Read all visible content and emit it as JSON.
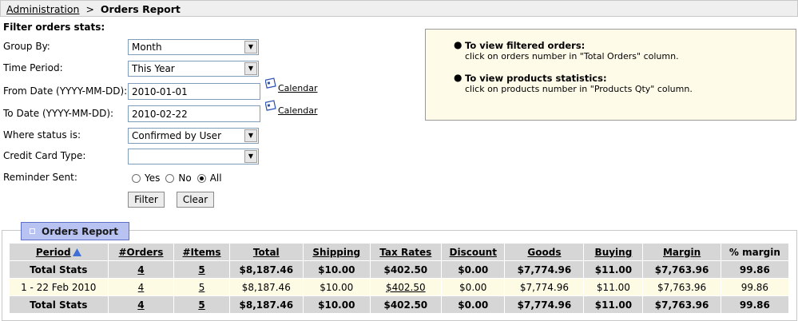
{
  "breadcrumb": {
    "parent": "Administration",
    "separator": ">",
    "current": "Orders Report"
  },
  "filter": {
    "title": "Filter orders stats:",
    "group_by": {
      "label": "Group By:",
      "value": "Month"
    },
    "time_period": {
      "label": "Time Period:",
      "value": "This Year"
    },
    "from_date": {
      "label": "From Date (YYYY-MM-DD):",
      "value": "2010-01-01",
      "calendar_label": "Calendar"
    },
    "to_date": {
      "label": "To Date (YYYY-MM-DD):",
      "value": "2010-02-22",
      "calendar_label": "Calendar"
    },
    "status": {
      "label": "Where status is:",
      "value": "Confirmed by User"
    },
    "credit_card": {
      "label": "Credit Card Type:",
      "value": ""
    },
    "reminder": {
      "label": "Reminder Sent:",
      "options": [
        "Yes",
        "No",
        "All"
      ],
      "selected": "All"
    },
    "filter_button": "Filter",
    "clear_button": "Clear"
  },
  "info": {
    "items": [
      {
        "title": "To view filtered orders:",
        "desc": "click on orders number in \"Total Orders\" column."
      },
      {
        "title": "To view products statistics:",
        "desc": "click on products number in \"Products Qty\" column."
      }
    ]
  },
  "report": {
    "tab_label": "Orders Report",
    "columns": [
      "Period",
      "#Orders",
      "#Items",
      "Total",
      "Shipping",
      "Tax Rates",
      "Discount",
      "Goods",
      "Buying",
      "Margin",
      "% margin"
    ],
    "rows": [
      {
        "type": "total",
        "cells": [
          "Total Stats",
          "4",
          "5",
          "$8,187.46",
          "$10.00",
          "$402.50",
          "$0.00",
          "$7,774.96",
          "$11.00",
          "$7,763.96",
          "99.86"
        ]
      },
      {
        "type": "data",
        "cells": [
          "1 - 22 Feb 2010",
          "4",
          "5",
          "$8,187.46",
          "$10.00",
          "$402.50",
          "$0.00",
          "$7,774.96",
          "$11.00",
          "$7,763.96",
          "99.86"
        ]
      },
      {
        "type": "total",
        "cells": [
          "Total Stats",
          "4",
          "5",
          "$8,187.46",
          "$10.00",
          "$402.50",
          "$0.00",
          "$7,774.96",
          "$11.00",
          "$7,763.96",
          "99.86"
        ]
      }
    ]
  },
  "colors": {
    "header_bg": "#d6d6d6",
    "data_row_bg": "#fdfbe3",
    "info_bg": "#fffbe9",
    "tab_bg": "#b9c3f2"
  }
}
